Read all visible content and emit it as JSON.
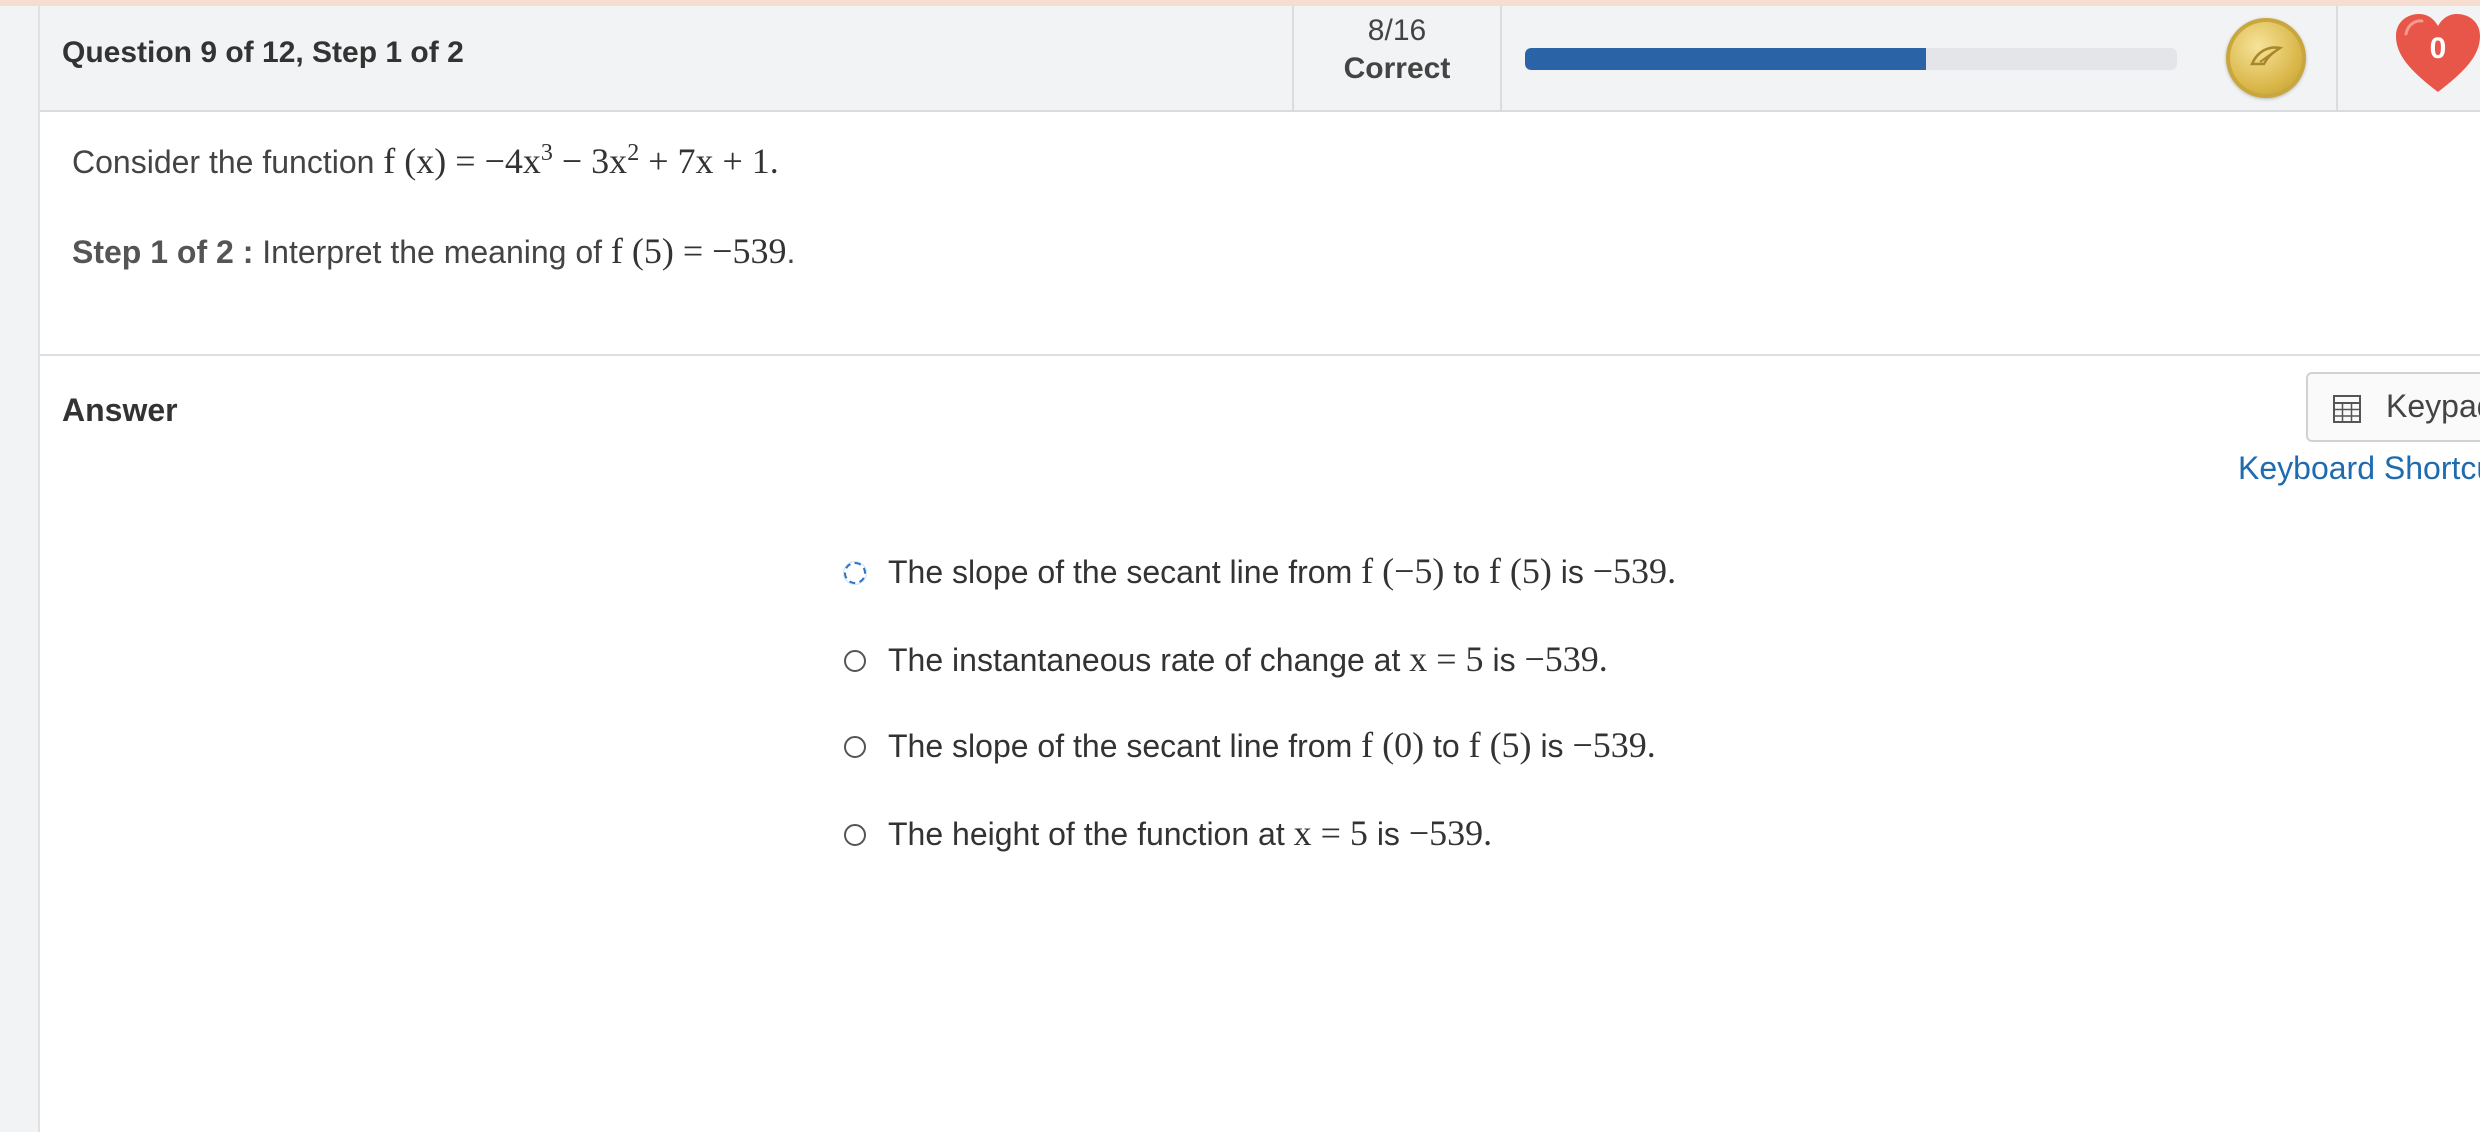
{
  "header": {
    "question_title": "Question 9 of 12, Step 1 of 2",
    "score_fraction": "8/16",
    "score_label": "Correct",
    "progress_fraction": 0.615,
    "lives_count": "0",
    "accent_color": "#2a64a6",
    "heart_color": "#e8564a"
  },
  "question": {
    "intro": "Consider the function ",
    "function_math": "f (x)  =  −4x",
    "exp1": "3",
    "mid": "  −  3x",
    "exp2": "2",
    "tail": "  +  7x  +  1.",
    "step_label": "Step 1 of 2 :",
    "step_text": " Interpret the meaning of ",
    "step_math": "f (5)  =  −539",
    "step_end": "."
  },
  "answer": {
    "heading": "Answer",
    "keypad_label": "Keypad",
    "shortcuts_label": "Keyboard Shortcuts"
  },
  "options": [
    {
      "pre": "The slope of the secant line from ",
      "m1": "f (−5)",
      "mid": " to ",
      "m2": "f (5)",
      "post": " is ",
      "m3": "−539",
      "end": "."
    },
    {
      "pre": "The instantaneous rate of change at ",
      "m1": "x  =  5",
      "mid": " is ",
      "m2": "−539",
      "end": "."
    },
    {
      "pre": "The slope of the secant line from ",
      "m1": "f (0)",
      "mid": " to ",
      "m2": "f (5)",
      "post": " is ",
      "m3": "−539",
      "end": "."
    },
    {
      "pre": "The height of the function at ",
      "m1": "x  =  5",
      "mid": " is ",
      "m2": "−539",
      "end": "."
    }
  ]
}
